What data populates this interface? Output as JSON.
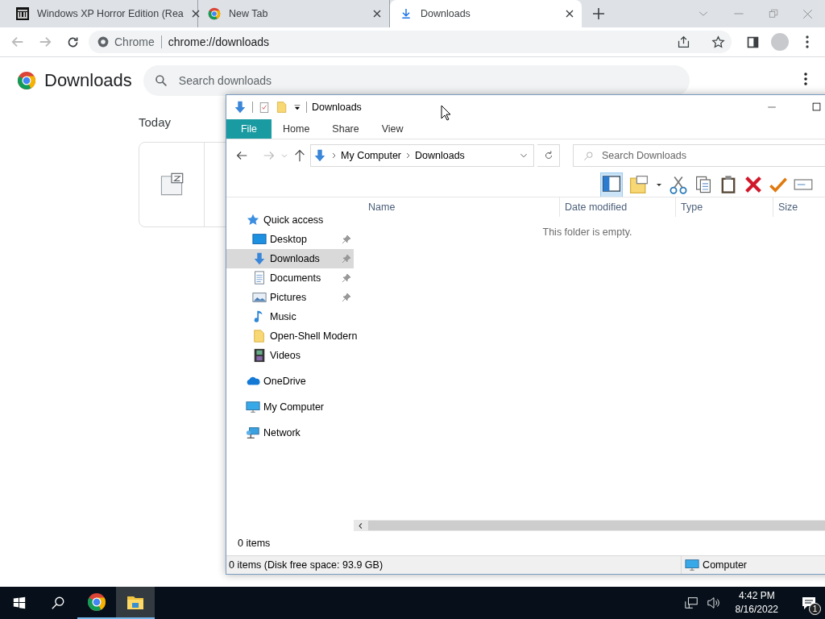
{
  "browser": {
    "tabs": [
      {
        "title": "Windows XP Horror Edition (Rea",
        "kind": "museum",
        "selected": false
      },
      {
        "title": "New Tab",
        "kind": "chrome",
        "selected": false
      },
      {
        "title": "Downloads",
        "kind": "download",
        "selected": true
      }
    ],
    "address": {
      "site_label": "Chrome",
      "url": "chrome://downloads"
    }
  },
  "page": {
    "title": "Downloads",
    "search": {
      "placeholder": "Search downloads"
    },
    "section": "Today"
  },
  "explorer": {
    "title": "Downloads",
    "ribbon_tabs": [
      {
        "label": "File",
        "selected": true
      },
      {
        "label": "Home",
        "selected": false
      },
      {
        "label": "Share",
        "selected": false
      },
      {
        "label": "View",
        "selected": false
      }
    ],
    "breadcrumbs": [
      "My Computer",
      "Downloads"
    ],
    "search": {
      "placeholder": "Search Downloads"
    },
    "nav": [
      {
        "label": "Quick access",
        "kind": "star",
        "selected": false,
        "children": [
          {
            "label": "Desktop",
            "kind": "desktop",
            "pinned": true,
            "selected": false
          },
          {
            "label": "Downloads",
            "kind": "download",
            "pinned": true,
            "selected": true
          },
          {
            "label": "Documents",
            "kind": "documents",
            "pinned": true,
            "selected": false
          },
          {
            "label": "Pictures",
            "kind": "pictures",
            "pinned": true,
            "selected": false
          },
          {
            "label": "Music",
            "kind": "music",
            "pinned": false,
            "selected": false
          },
          {
            "label": "Open-Shell Modern",
            "kind": "folder",
            "pinned": false,
            "selected": false
          },
          {
            "label": "Videos",
            "kind": "videos",
            "pinned": false,
            "selected": false
          }
        ]
      },
      {
        "label": "OneDrive",
        "kind": "cloud",
        "selected": false
      },
      {
        "label": "My Computer",
        "kind": "computer",
        "selected": false
      },
      {
        "label": "Network",
        "kind": "network",
        "selected": false
      }
    ],
    "columns": [
      "Name",
      "Date modified",
      "Type",
      "Size"
    ],
    "empty_message": "This folder is empty.",
    "item_count": "0 items",
    "status": "0 items (Disk free space: 93.9 GB)",
    "status_right": "Computer"
  },
  "taskbar": {
    "apps": [
      {
        "kind": "chrome",
        "selected": false
      },
      {
        "kind": "explorer",
        "selected": true
      }
    ],
    "time": "4:42 PM",
    "date": "8/16/2022",
    "notification_count": "1"
  }
}
